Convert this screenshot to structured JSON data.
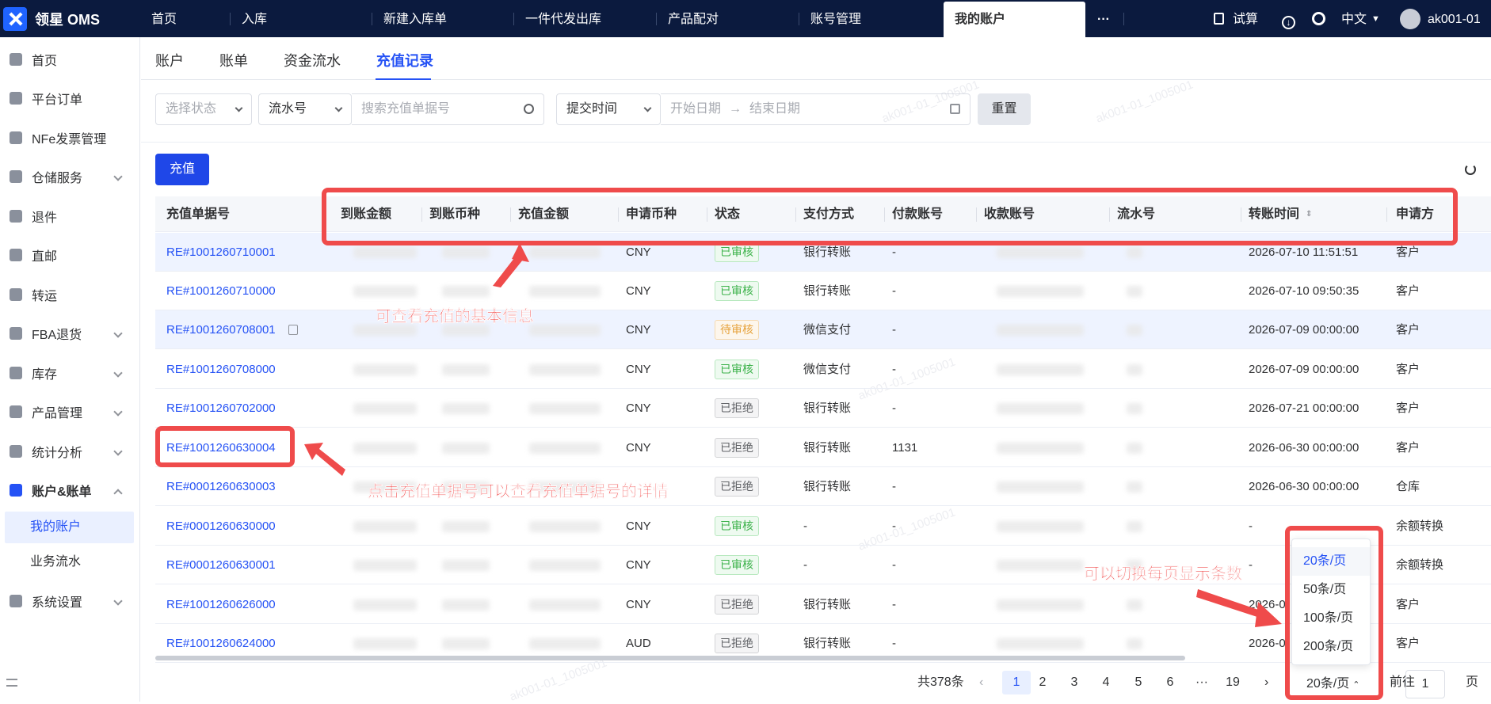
{
  "app": {
    "logo_text": "领星 OMS"
  },
  "topnav": {
    "tabs": [
      "首页",
      "入库",
      "新建入库单",
      "一件代发出库",
      "产品配对",
      "账号管理",
      "我的账户"
    ],
    "active": "我的账户",
    "more": "···",
    "calc": "试算",
    "lang": "中文",
    "user": "ak001-01"
  },
  "sidebar": {
    "items": [
      "首页",
      "平台订单",
      "NFe发票管理",
      "仓储服务",
      "退件",
      "直邮",
      "转运",
      "FBA退货",
      "库存",
      "产品管理",
      "统计分析",
      "账户&账单",
      "系统设置"
    ],
    "sub": [
      "我的账户",
      "业务流水"
    ]
  },
  "pagetabs": {
    "tabs": [
      "账户",
      "账单",
      "资金流水",
      "充值记录"
    ],
    "active": "充值记录"
  },
  "filters": {
    "status_placeholder": "选择状态",
    "serial_type": "流水号",
    "search_placeholder": "搜索充值单据号",
    "time_type": "提交时间",
    "start_placeholder": "开始日期",
    "end_placeholder": "结束日期",
    "reset": "重置"
  },
  "actions": {
    "recharge": "充值"
  },
  "table": {
    "headers": [
      "充值单据号",
      "到账金额",
      "到账币种",
      "充值金额",
      "申请币种",
      "状态",
      "支付方式",
      "付款账号",
      "收款账号",
      "流水号",
      "转账时间",
      "申请方"
    ],
    "rows": [
      {
        "id": "RE#1001260710001",
        "currency": "CNY",
        "status": "已审核",
        "pay": "银行转账",
        "payer": "-",
        "time": "2026-07-10 11:51:51",
        "applicant": "客户"
      },
      {
        "id": "RE#1001260710000",
        "currency": "CNY",
        "status": "已审核",
        "pay": "银行转账",
        "payer": "-",
        "time": "2026-07-10 09:50:35",
        "applicant": "客户"
      },
      {
        "id": "RE#1001260708001",
        "currency": "CNY",
        "status": "待审核",
        "pay": "微信支付",
        "payer": "-",
        "time": "2026-07-09 00:00:00",
        "applicant": "客户"
      },
      {
        "id": "RE#1001260708000",
        "currency": "CNY",
        "status": "已审核",
        "pay": "微信支付",
        "payer": "-",
        "time": "2026-07-09 00:00:00",
        "applicant": "客户"
      },
      {
        "id": "RE#1001260702000",
        "currency": "CNY",
        "status": "已拒绝",
        "pay": "银行转账",
        "payer": "-",
        "time": "2026-07-21 00:00:00",
        "applicant": "客户"
      },
      {
        "id": "RE#1001260630004",
        "currency": "CNY",
        "status": "已拒绝",
        "pay": "银行转账",
        "payer": "1131",
        "time": "2026-06-30 00:00:00",
        "applicant": "客户"
      },
      {
        "id": "RE#0001260630003",
        "currency": "",
        "status": "已拒绝",
        "pay": "银行转账",
        "payer": "-",
        "time": "2026-06-30 00:00:00",
        "applicant": "仓库"
      },
      {
        "id": "RE#0001260630000",
        "currency": "CNY",
        "status": "已审核",
        "pay": "-",
        "payer": "-",
        "time": "-",
        "applicant": "余额转换"
      },
      {
        "id": "RE#0001260630001",
        "currency": "CNY",
        "status": "已审核",
        "pay": "-",
        "payer": "-",
        "time": "-",
        "applicant": "余额转换"
      },
      {
        "id": "RE#1001260626000",
        "currency": "CNY",
        "status": "已拒绝",
        "pay": "银行转账",
        "payer": "-",
        "time": "2026-0",
        "applicant": "客户"
      },
      {
        "id": "RE#1001260624000",
        "currency": "AUD",
        "status": "已拒绝",
        "pay": "银行转账",
        "payer": "-",
        "time": "2026-0",
        "applicant": "客户"
      }
    ]
  },
  "pagination": {
    "total": "共378条",
    "pages": [
      "1",
      "2",
      "3",
      "4",
      "5",
      "6",
      "···",
      "19"
    ],
    "current": "1",
    "size": "20条/页",
    "goto": "前往",
    "goto_value": "1",
    "page_unit": "页",
    "options": [
      "20条/页",
      "50条/页",
      "100条/页",
      "200条/页"
    ]
  },
  "annotations": {
    "header": "可查看充值的基本信息",
    "link": "点击充值单据号可以查看充值单据号的详情",
    "pagesize": "可以切换每页显示条数"
  },
  "watermark": "ak001-01_1005001",
  "colors": {
    "accent": "#2552f5",
    "annotation": "#ef4b4b",
    "nav": "#0b1a3e"
  }
}
